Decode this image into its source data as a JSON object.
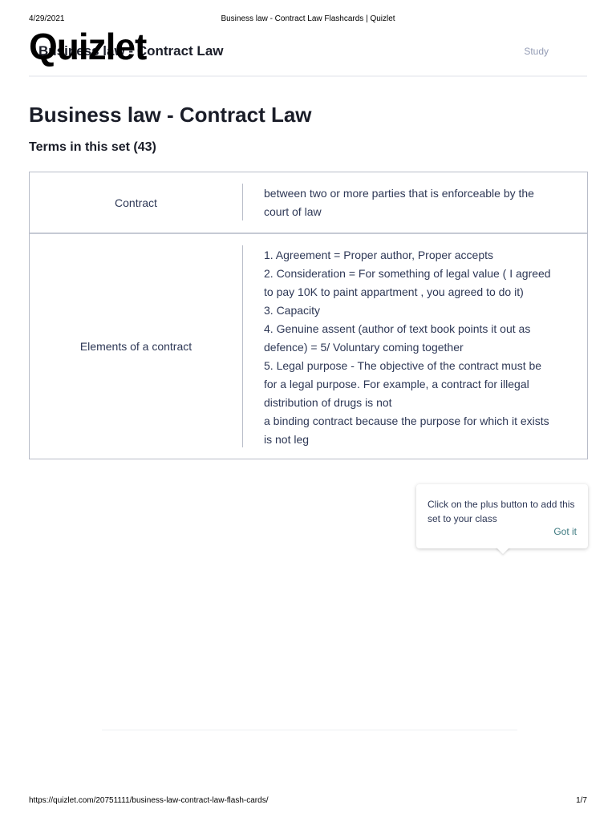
{
  "print_header": {
    "date": "4/29/2021",
    "title": "Business law - Contract Law Flashcards | Quizlet"
  },
  "topbar": {
    "logo": "Quizlet",
    "set_name": "Business law - Contract Law",
    "study_label": "Study"
  },
  "page": {
    "title": "Business law - Contract Law",
    "terms_heading": "Terms in this set (43)"
  },
  "terms": [
    {
      "term": "Contract",
      "definition_lines": [
        "between two or more parties that is enforceable by the",
        "court of law"
      ]
    },
    {
      "term": "Elements of a contract",
      "definition_lines": [
        "1. Agreement = Proper author, Proper accepts",
        "2. Consideration = For something of legal value ( I agreed",
        "to pay 10K to paint appartment , you agreed to do it)",
        "3. Capacity",
        "4. Genuine assent (author of text book points it out as",
        "defence) = 5/ Voluntary coming together",
        "5. Legal purpose - The objective of the contract must be",
        "for a legal purpose. For example, a contract for illegal",
        "distribution of drugs is not",
        "a binding contract because the purpose for which it exists",
        "is not leg"
      ]
    }
  ],
  "tooltip": {
    "text": "Click on the plus button to add this set to your class",
    "button_label": "Got it"
  },
  "print_footer": {
    "url": "https://quizlet.com/20751111/business-law-contract-law-flash-cards/",
    "page": "1/7"
  }
}
